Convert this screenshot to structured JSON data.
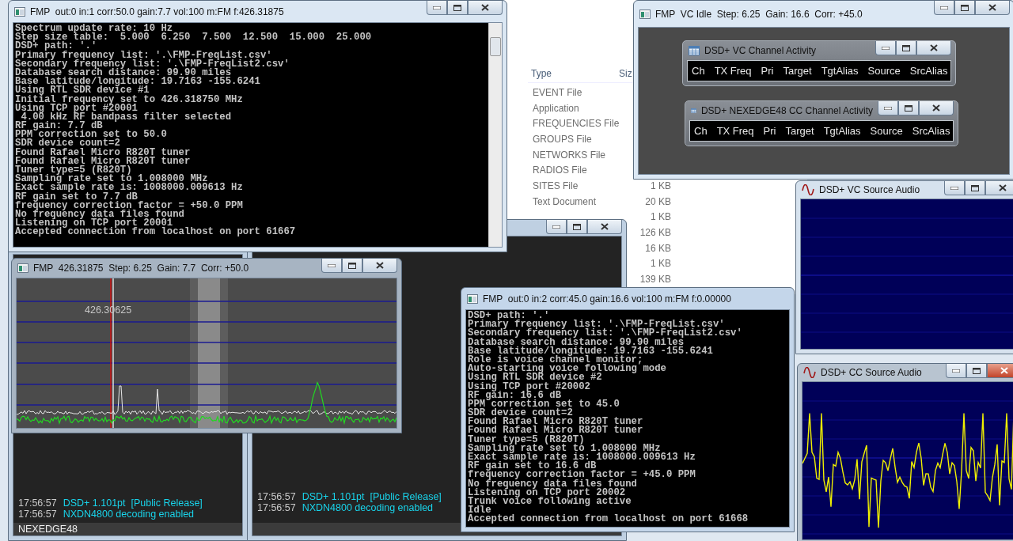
{
  "explorer": {
    "columns": [
      "Type",
      "Siz"
    ],
    "rows": [
      {
        "type": "EVENT File"
      },
      {
        "type": "Application"
      },
      {
        "type": "FREQUENCIES File"
      },
      {
        "type": "GROUPS File"
      },
      {
        "type": "NETWORKS File"
      },
      {
        "type": "RADIOS File"
      },
      {
        "type": "SITES File",
        "size": "1 KB"
      },
      {
        "type": "Text Document",
        "size": "20 KB"
      },
      {
        "size": "1 KB"
      },
      {
        "size": "126 KB"
      },
      {
        "size": "16 KB"
      },
      {
        "size": "1 KB"
      },
      {
        "size": "139 KB"
      }
    ]
  },
  "log_windows": [
    {
      "lines": [
        {
          "time": "17:56:57",
          "message": "DSD+ 1.101pt  [Public Release]"
        },
        {
          "time": "17:56:57",
          "message": "NXDN4800 decoding enabled"
        }
      ],
      "status": "NEXEDGE48"
    },
    {
      "lines": [
        {
          "time": "17:56:57",
          "message": "DSD+ 1.101pt  [Public Release]"
        },
        {
          "time": "17:56:57",
          "message": "NXDN4800 decoding enabled"
        }
      ]
    }
  ],
  "consoles": [
    {
      "title": "FMP  out:0 in:1 corr:50.0 gain:7.7 vol:100 m:FM f:426.31875",
      "lines": [
        "Spectrum update rate: 10 Hz",
        "Step size table:  5.000  6.250  7.500  12.500  15.000  25.000",
        "DSD+ path: '.'",
        "Primary frequency list: '.\\FMP-FreqList.csv'",
        "Secondary frequency list: '.\\FMP-FreqList2.csv'",
        "Database search distance: 99.90 miles",
        "Base latitude/longitude: 19.7163 -155.6241",
        "Using RTL SDR device #1",
        "Initial frequency set to 426.318750 MHz",
        "Using TCP port #20001",
        " 4.00 kHz RF bandpass filter selected",
        "RF gain: 7.7 dB",
        "PPM correction set to 50.0",
        "SDR device count=2",
        "Found Rafael Micro R820T tuner",
        "Found Rafael Micro R820T tuner",
        "Tuner type=5 (R820T)",
        "Sampling rate set to 1.008000 MHz",
        "Exact sample rate is: 1008000.009613 Hz",
        "RF gain set to 7.7 dB",
        "frequency correction factor = +50.0 PPM",
        "No frequency data files found",
        "Listening on TCP port 20001",
        "Accepted connection from localhost on port 61667"
      ]
    },
    {
      "title": "FMP  out:0 in:2 corr:45.0 gain:16.6 vol:100 m:FM f:0.00000",
      "lines": [
        "DSD+ path: '.'",
        "Primary frequency list: '.\\FMP-FreqList.csv'",
        "Secondary frequency list: '.\\FMP-FreqList2.csv'",
        "Database search distance: 99.90 miles",
        "Base latitude/longitude: 19.7163 -155.6241",
        "Role is voice channel monitor;",
        "Auto-starting voice following mode",
        "Using RTL SDR device #2",
        "Using TCP port #20002",
        "RF gain: 16.6 dB",
        "PPM correction set to 45.0",
        "SDR device count=2",
        "Found Rafael Micro R820T tuner",
        "Found Rafael Micro R820T tuner",
        "Tuner type=5 (R820T)",
        "Sampling rate set to 1.008000 MHz",
        "Exact sample rate is: 1008000.009613 Hz",
        "RF gain set to 16.6 dB",
        "frequency correction factor = +45.0 PPM",
        "No frequency data files found",
        "Listening on TCP port 20002",
        "Trunk voice following active",
        "Idle",
        "Accepted connection from localhost on port 61668"
      ]
    }
  ],
  "spectrum_window": {
    "title": "FMP  426.31875  Step: 6.25  Gain: 7.7  Corr: +50.0",
    "marker_label": "426.30625"
  },
  "vc_window": {
    "title": "FMP  VC Idle  Step: 6.25  Gain: 16.6  Corr: +45.0",
    "panels": [
      {
        "title": "DSD+ VC Channel Activity",
        "columns": [
          "Ch",
          "TX Freq",
          "Pri",
          "Target",
          "TgtAlias",
          "Source",
          "SrcAlias"
        ]
      },
      {
        "title": "DSD+ NEXEDGE48 CC Channel Activity",
        "columns": [
          "Ch",
          "TX Freq",
          "Pri",
          "Target",
          "TgtAlias",
          "Source",
          "SrcAlias"
        ]
      }
    ]
  },
  "audio_windows": [
    {
      "title": "DSD+ VC Source Audio",
      "signal": false,
      "close_hover": false
    },
    {
      "title": "DSD+ CC Source Audio",
      "signal": true,
      "close_hover": true
    }
  ]
}
